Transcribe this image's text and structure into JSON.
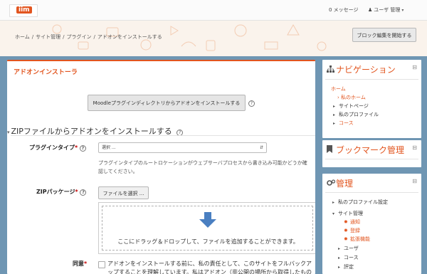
{
  "navbar": {
    "logo_text": "iim",
    "messages": "0 メッセージ",
    "user": "ユーザ 管理"
  },
  "breadcrumb": [
    "ホーム",
    "サイト管理",
    "プラグイン",
    "アドオンをインストールする"
  ],
  "header": {
    "edit_button": "ブロック編集を開始する"
  },
  "main": {
    "title": "アドオンインストーラ",
    "directory_button": "Moodleプラグインディレクトリからアドオンをインストールする",
    "section_title": "ZIPファイルからアドオンをインストールする",
    "plugin_type_label": "プラグインタイプ",
    "select_value": "選択 ...",
    "description": "プラグインタイプのルートロケーションがウェブサーバプロセスから書き込み可能かどうか確認してください。",
    "zip_label": "ZIPパッケージ",
    "file_button": "ファイルを選択 ...",
    "drop_text": "ここにドラッグ＆ドロップして、ファイルを追加することができます。",
    "agree_label": "同意",
    "agree_text": "アドオンをインストールする前に、私の責任として、このサイトをフルバックアップすることを理解しています。私はアドオン（非公開の場所から取得したものに限らず）に"
  },
  "navigation_block": {
    "title": "ナビゲーション",
    "items": [
      {
        "label": "ホーム"
      },
      {
        "label": "私のホーム"
      },
      {
        "label": "サイトページ"
      },
      {
        "label": "私のプロファイル"
      },
      {
        "label": "コース"
      }
    ]
  },
  "bookmark_block": {
    "title": "ブックマーク管理"
  },
  "admin_block": {
    "title": "管理",
    "items": [
      {
        "label": "私のプロファイル設定"
      },
      {
        "label": "サイト管理"
      },
      {
        "label": "通知"
      },
      {
        "label": "登録"
      },
      {
        "label": "拡張機能"
      },
      {
        "label": "ユーザ"
      },
      {
        "label": "コース"
      },
      {
        "label": "評定"
      }
    ]
  },
  "colors": {
    "accent": "#e2551f",
    "background": "#6f96b3"
  }
}
